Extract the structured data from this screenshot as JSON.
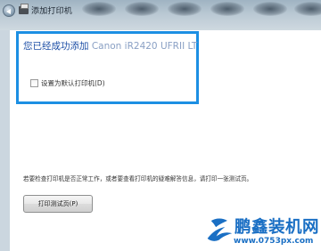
{
  "window": {
    "title": "添加打印机"
  },
  "main": {
    "headline": "您已经成功添加",
    "headline_printer": " Canon iR2420 UFRII LT",
    "set_default_label": "设置为默认打印机(D)",
    "set_default_checked": false,
    "test_hint": "若要检查打印机是否正常工作，或者要查看打印机的疑难解答信息，请打印一张测试页。",
    "print_test_button": "打印测试页(P)"
  },
  "watermark": {
    "brand": "鹏鑫装机网",
    "url": "www.0753px.com"
  },
  "colors": {
    "accent": "#1c8fe3",
    "headline": "#1e4fa6",
    "watermark": "#1a6fc4"
  }
}
